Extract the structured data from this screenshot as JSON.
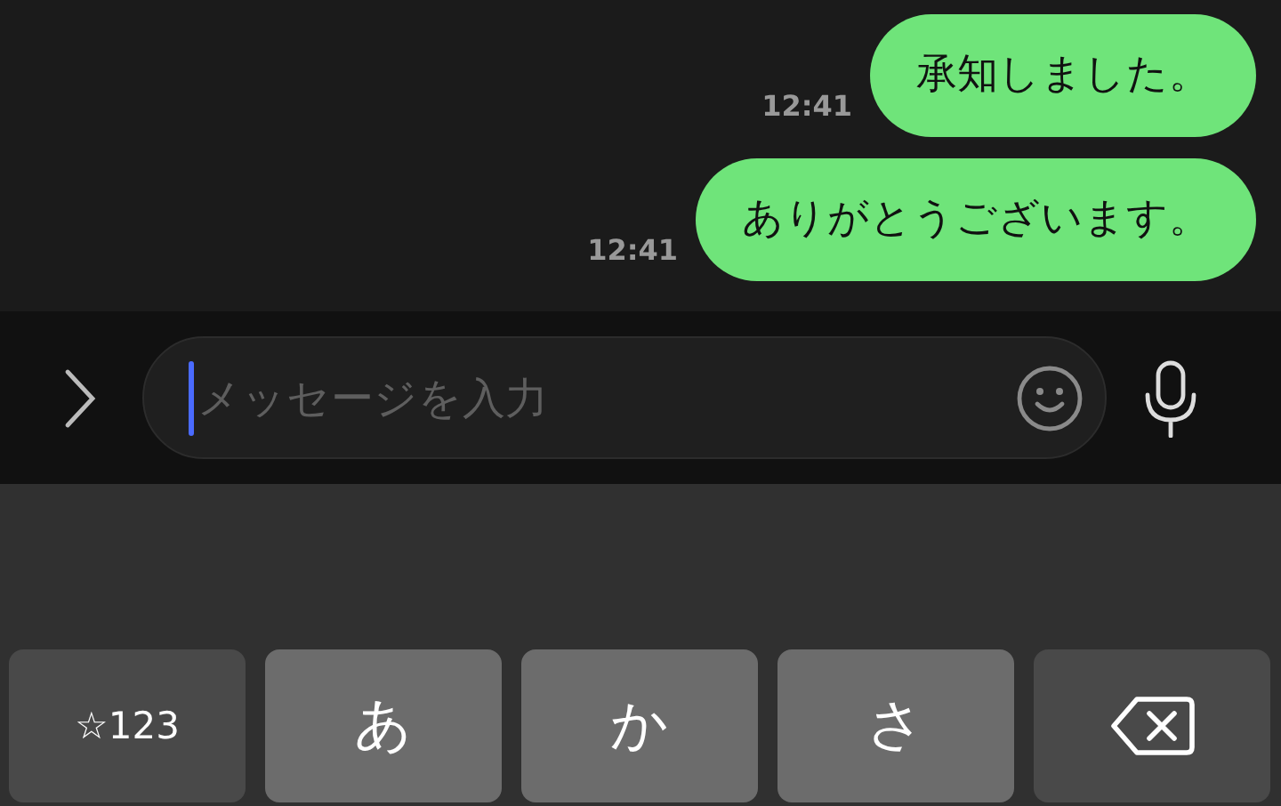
{
  "messages": [
    {
      "text": "承知しました。",
      "time": "12:41"
    },
    {
      "text": "ありがとうございます。",
      "time": "12:41"
    }
  ],
  "composer": {
    "placeholder": "メッセージを入力"
  },
  "keyboard": {
    "keys": [
      {
        "kind": "function",
        "label": "☆123"
      },
      {
        "kind": "letter",
        "label": "あ"
      },
      {
        "kind": "letter",
        "label": "か"
      },
      {
        "kind": "letter",
        "label": "さ"
      },
      {
        "kind": "backspace"
      }
    ]
  }
}
